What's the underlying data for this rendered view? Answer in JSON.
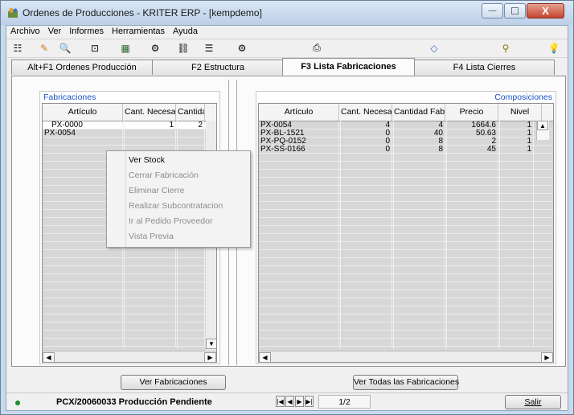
{
  "window": {
    "title": "Ordenes de Producciones - KRITER ERP - [kempdemo]",
    "controls": {
      "minimize": "—",
      "maximize": "☐",
      "close": "X"
    }
  },
  "menu": [
    "Archivo",
    "Ver",
    "Informes",
    "Herramientas",
    "Ayuda"
  ],
  "toolbar": [
    {
      "icon": "tree-icon",
      "glyph": "☷"
    },
    {
      "icon": "pencil-icon",
      "glyph": "✎"
    },
    {
      "icon": "preview-icon",
      "glyph": "🔍"
    },
    {
      "icon": "zoom-icon",
      "glyph": "⊡"
    },
    {
      "icon": "chart-icon",
      "glyph": "▦"
    },
    {
      "icon": "gear-icon",
      "glyph": "⚙"
    },
    {
      "icon": "link-icon",
      "glyph": "⛓"
    },
    {
      "icon": "list-check-icon",
      "glyph": "☰"
    },
    {
      "icon": "settings-icon",
      "glyph": "⚙"
    },
    {
      "icon": "printer-icon",
      "glyph": "⎙"
    },
    {
      "icon": "eraser-icon",
      "glyph": "◇"
    },
    {
      "icon": "paperclip-icon",
      "glyph": "⚲"
    },
    {
      "icon": "lightbulb-icon",
      "glyph": "💡"
    }
  ],
  "tabs": [
    {
      "label": "Alt+F1 Ordenes Producción",
      "active": false
    },
    {
      "label": "F2 Estructura",
      "active": false
    },
    {
      "label": "F3 Lista Fabricaciones",
      "active": true
    },
    {
      "label": "F4 Lista Cierres",
      "active": false
    }
  ],
  "fabricaciones": {
    "title": "Fabricaciones",
    "columns": [
      "Artículo",
      "Cant. Necesaria",
      "Cantidad"
    ],
    "rows": [
      [
        "PX-0000",
        "1",
        "2"
      ],
      [
        "PX-0054",
        "",
        ""
      ]
    ],
    "button": "Ver Fabricaciones"
  },
  "context_menu": {
    "items": [
      {
        "label": "Ver Stock",
        "enabled": true
      },
      {
        "label": "Cerrar Fabricación",
        "enabled": false
      },
      {
        "label": "Eliminar Cierre",
        "enabled": false
      },
      {
        "label": "Realizar Subcontratacion",
        "enabled": false
      },
      {
        "label": "Ir al Pedido Proveedor",
        "enabled": false
      },
      {
        "label": "Vista Previa",
        "enabled": false
      }
    ]
  },
  "composiciones": {
    "title": "Composiciones",
    "columns": [
      "Artículo",
      "Cant. Necesaria",
      "Cantidad Fabricac",
      "Precio",
      "Nivel"
    ],
    "rows": [
      [
        "PX-0054",
        "4",
        "4",
        "1664.6",
        "1"
      ],
      [
        "PX-BL-1521",
        "0",
        "40",
        "50.63",
        "1"
      ],
      [
        "PX-PQ-0152",
        "0",
        "8",
        "2",
        "1"
      ],
      [
        "PX-SS-0166",
        "0",
        "8",
        "45",
        "1"
      ]
    ],
    "button": "Ver Todas las Fabricaciones"
  },
  "status": {
    "order": "PCX/20060033 Producción Pendiente",
    "page": "1/2",
    "exit": "Salir"
  }
}
